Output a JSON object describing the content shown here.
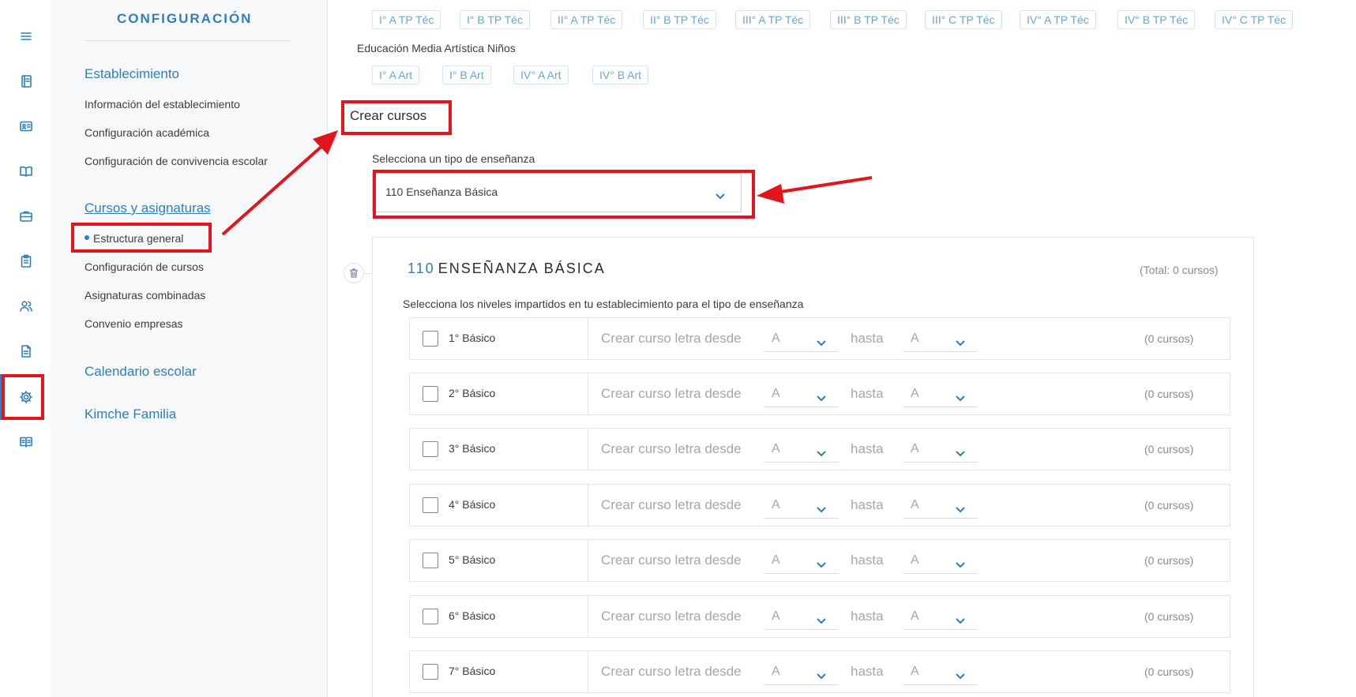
{
  "rail": {
    "icons": [
      "menu-icon",
      "notebook-icon",
      "id-card-icon",
      "open-book-icon",
      "briefcase-icon",
      "clipboard-icon",
      "users-icon",
      "document-icon",
      "gear-icon",
      "book-icon"
    ]
  },
  "sidebar": {
    "title": "CONFIGURACIÓN",
    "sections": [
      {
        "heading": "Establecimiento",
        "items": [
          "Información del establecimiento",
          "Configuración académica",
          "Configuración de convivencia escolar"
        ]
      },
      {
        "heading": "Cursos y asignaturas",
        "items": [
          "Estructura general",
          "Configuración de cursos",
          "Asignaturas combinadas",
          "Convenio empresas"
        ]
      },
      {
        "heading": "Calendario escolar",
        "items": []
      },
      {
        "heading": "Kimche Familia",
        "items": []
      }
    ]
  },
  "course_chips_top": [
    "I° A TP Téc",
    "I° B TP Téc",
    "II° A TP Téc",
    "II° B TP Téc",
    "III° A TP Téc",
    "III° B TP Téc",
    "III° C TP Téc",
    "IV° A TP Téc",
    "IV° B TP Téc",
    "IV° C TP Téc"
  ],
  "art_group": {
    "label": "Educación Media Artística Niños",
    "chips": [
      "I° A Art",
      "I° B Art",
      "IV° A Art",
      "IV° B Art"
    ]
  },
  "crear": {
    "title": "Crear cursos",
    "select_label": "Selecciona un tipo de enseñanza",
    "selected": "110 Enseñanza Básica"
  },
  "panel": {
    "code": "110",
    "title": "ENSEÑANZA BÁSICA",
    "total": "(Total: 0 cursos)",
    "subtitle": "Selecciona los niveles impartidos en tu establecimiento para el tipo de enseñanza",
    "crear_label": "Crear curso letra desde",
    "hasta_label": "hasta",
    "levels": [
      {
        "name": "1° Básico",
        "from": "A",
        "to": "A",
        "count": "(0 cursos)"
      },
      {
        "name": "2° Básico",
        "from": "A",
        "to": "A",
        "count": "(0 cursos)"
      },
      {
        "name": "3° Básico",
        "from": "A",
        "to": "A",
        "count": "(0 cursos)"
      },
      {
        "name": "4° Básico",
        "from": "A",
        "to": "A",
        "count": "(0 cursos)"
      },
      {
        "name": "5° Básico",
        "from": "A",
        "to": "A",
        "count": "(0 cursos)"
      },
      {
        "name": "6° Básico",
        "from": "A",
        "to": "A",
        "count": "(0 cursos)"
      },
      {
        "name": "7° Básico",
        "from": "A",
        "to": "A",
        "count": "(0 cursos)"
      }
    ]
  },
  "colors": {
    "accent": "#2f7fb8",
    "annotation_red": "#e3151c"
  }
}
